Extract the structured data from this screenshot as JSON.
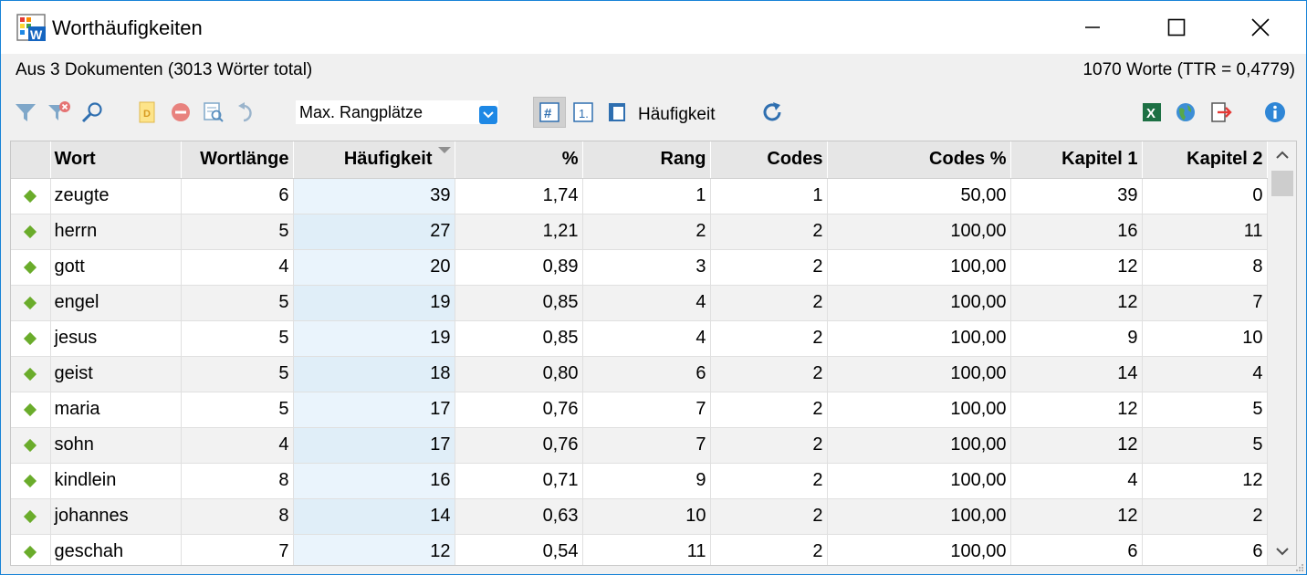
{
  "window": {
    "title": "Worthäufigkeiten"
  },
  "info": {
    "left": "Aus 3 Dokumenten (3013 Wörter total)",
    "right": "1070 Worte (TTR = 0,4779)"
  },
  "toolbar": {
    "dropdown_value": "Max. Rangplätze",
    "sort_label": "Häufigkeit",
    "icons": [
      "filter-icon",
      "clear-filter-icon",
      "search-icon",
      "document-icon",
      "delete-icon",
      "preview-icon",
      "undo-icon",
      "hash-toggle-icon",
      "rank-toggle-icon",
      "page-icon",
      "refresh-icon",
      "excel-export-icon",
      "web-export-icon",
      "export-icon",
      "info-icon"
    ]
  },
  "table": {
    "columns": [
      "Wort",
      "Wortlänge",
      "Häufigkeit",
      "%",
      "Rang",
      "Codes",
      "Codes %",
      "Kapitel 1",
      "Kapitel 2"
    ],
    "rows": [
      [
        "zeugte",
        "6",
        "39",
        "1,74",
        "1",
        "1",
        "50,00",
        "39",
        "0"
      ],
      [
        "herrn",
        "5",
        "27",
        "1,21",
        "2",
        "2",
        "100,00",
        "16",
        "11"
      ],
      [
        "gott",
        "4",
        "20",
        "0,89",
        "3",
        "2",
        "100,00",
        "12",
        "8"
      ],
      [
        "engel",
        "5",
        "19",
        "0,85",
        "4",
        "2",
        "100,00",
        "12",
        "7"
      ],
      [
        "jesus",
        "5",
        "19",
        "0,85",
        "4",
        "2",
        "100,00",
        "9",
        "10"
      ],
      [
        "geist",
        "5",
        "18",
        "0,80",
        "6",
        "2",
        "100,00",
        "14",
        "4"
      ],
      [
        "maria",
        "5",
        "17",
        "0,76",
        "7",
        "2",
        "100,00",
        "12",
        "5"
      ],
      [
        "sohn",
        "4",
        "17",
        "0,76",
        "7",
        "2",
        "100,00",
        "12",
        "5"
      ],
      [
        "kindlein",
        "8",
        "16",
        "0,71",
        "9",
        "2",
        "100,00",
        "4",
        "12"
      ],
      [
        "johannes",
        "8",
        "14",
        "0,63",
        "10",
        "2",
        "100,00",
        "12",
        "2"
      ],
      [
        "geschah",
        "7",
        "12",
        "0,54",
        "11",
        "2",
        "100,00",
        "6",
        "6"
      ]
    ]
  },
  "colors": {
    "accent": "#1883d7",
    "marker": "#6aac2b",
    "sorted_column": "#eaf4fc"
  }
}
